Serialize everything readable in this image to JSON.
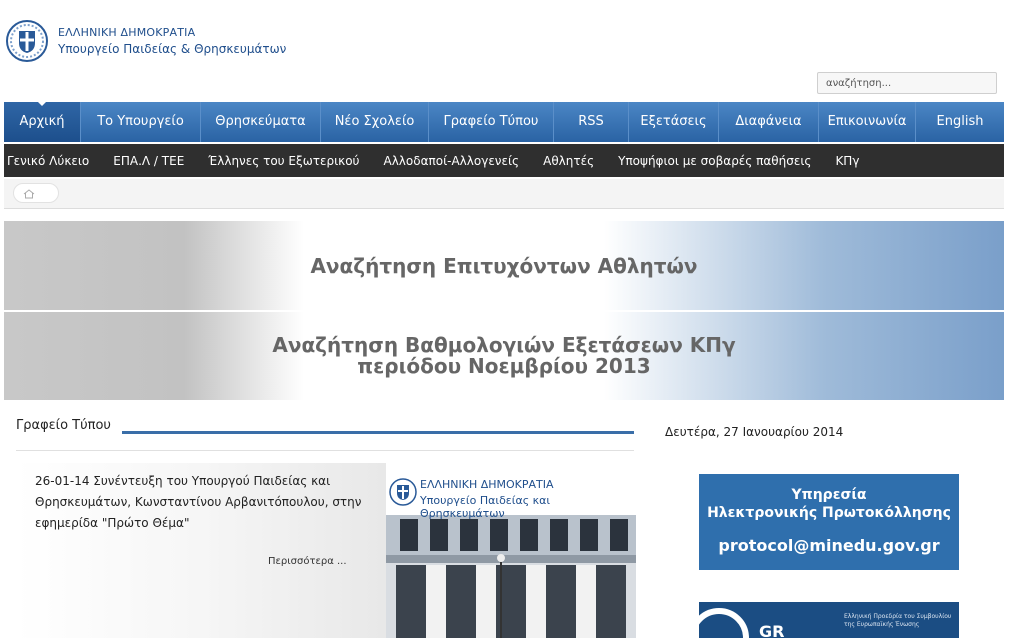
{
  "header": {
    "brand_line1": "ΕΛΛΗΝΙΚΗ ΔΗΜΟΚΡΑΤΙΑ",
    "brand_line2": "Υπουργείο Παιδείας & Θρησκευμάτων",
    "logo_icon": "greek-coat-of-arms-icon"
  },
  "search": {
    "placeholder": "αναζήτηση..."
  },
  "main_nav": {
    "items": [
      {
        "label": "Αρχική"
      },
      {
        "label": "Το Υπουργείο"
      },
      {
        "label": "Θρησκεύματα"
      },
      {
        "label": "Νέο Σχολείο"
      },
      {
        "label": "Γραφείο Τύπου"
      },
      {
        "label": "RSS"
      },
      {
        "label": "Εξετάσεις"
      },
      {
        "label": "Διαφάνεια"
      },
      {
        "label": "Επικοινωνία"
      },
      {
        "label": "English"
      }
    ],
    "active": "Αρχική"
  },
  "sub_nav": {
    "items": [
      {
        "label": "Γενικό Λύκειο"
      },
      {
        "label": "ΕΠΑ.Λ / ΤΕΕ"
      },
      {
        "label": "Έλληνες του Εξωτερικού"
      },
      {
        "label": "Αλλοδαποί-Αλλογενείς"
      },
      {
        "label": "Αθλητές"
      },
      {
        "label": "Υποψήφιοι με σοβαρές παθήσεις"
      },
      {
        "label": "ΚΠγ"
      }
    ]
  },
  "breadcrumb": {
    "icon": "home-icon"
  },
  "banners": {
    "banner1": "Αναζήτηση Επιτυχόντων Αθλητών",
    "banner2_line1": "Αναζήτηση Βαθμολογιών Εξετάσεων ΚΠγ",
    "banner2_line2": "περιόδου Νοεμβρίου 2013"
  },
  "press": {
    "title": "Γραφείο Τύπου",
    "article_text": "26-01-14 Συνέντευξη του Υπουργού Παιδείας και Θρησκευμάτων, Κωνσταντίνου Αρβανιτόπουλου, στην εφημερίδα \"Πρώτο Θέμα\"",
    "more_label": "Περισσότερα ...",
    "image_line1": "ΕΛΛΗΝΙΚΗ ΔΗΜΟΚΡΑΤΙΑ",
    "image_line2": "Υπουργείο Παιδείας και Θρησκευμάτων"
  },
  "sidebar": {
    "date": "Δευτέρα, 27 Ιανουαρίου 2014",
    "promo_line1": "Υπηρεσία",
    "promo_line2": "Ηλεκτρονικής Πρωτοκόλλησης",
    "promo_email": "protocol@minedu.gov.gr",
    "promo2_gr": "GR",
    "promo2_text": "Ελληνική Προεδρία του Συμβουλίου της Ευρωπαϊκής Ένωσης"
  },
  "colors": {
    "nav_blue": "#2a63a4",
    "subnav_dark": "#2f2f2f",
    "promo_blue": "#2f6fad",
    "brand_blue": "#1f4e8c"
  }
}
